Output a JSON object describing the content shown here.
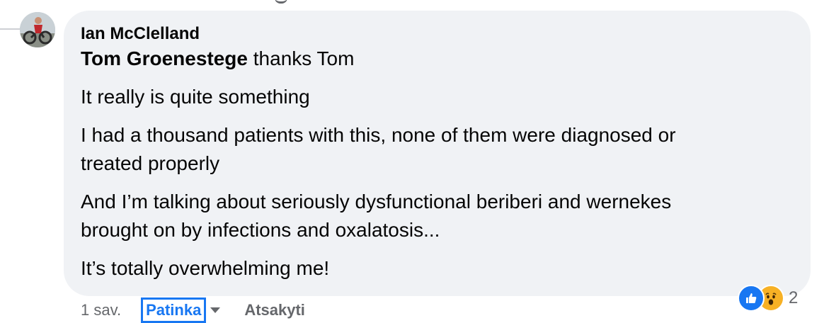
{
  "comment": {
    "author": "Ian McClelland",
    "mention": "Tom Groenestege",
    "lines": {
      "first_rest": " thanks Tom",
      "p1": "It really is quite something",
      "p2a": "I had a thousand patients with this, none of them were diagnosed or",
      "p2b": "treated properly",
      "p3a": "And I’m talking about seriously dysfunctional beriberi and wernekes",
      "p3b": "brought on by infections and oxalatosis...",
      "p4": "It’s totally overwhelming me!"
    }
  },
  "reactions": {
    "icons": [
      "like-icon",
      "wow-icon"
    ],
    "count": "2"
  },
  "actions": {
    "timestamp": "1 sav.",
    "like_label": "Patinka",
    "reply_label": "Atsakyti"
  },
  "colors": {
    "bubble": "#f0f2f5",
    "accent": "#1877f2",
    "muted": "#65676b",
    "wow": "#f7b125"
  }
}
